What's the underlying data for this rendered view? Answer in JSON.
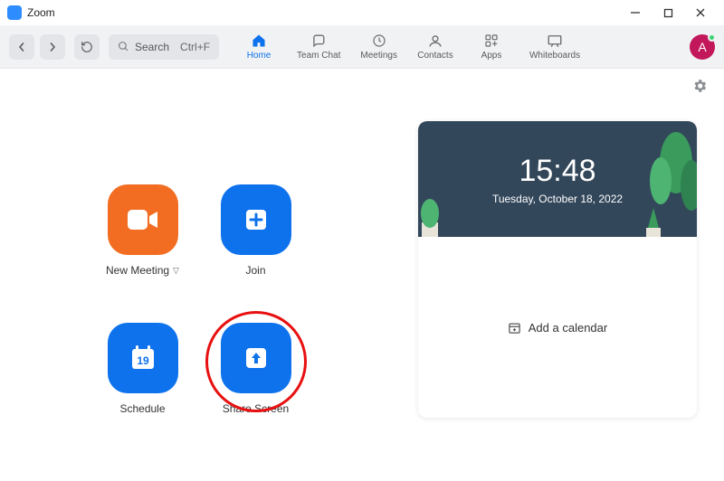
{
  "window": {
    "title": "Zoom"
  },
  "toolbar": {
    "search_placeholder": "Search",
    "search_shortcut": "Ctrl+F"
  },
  "tabs": {
    "home": "Home",
    "team_chat": "Team Chat",
    "meetings": "Meetings",
    "contacts": "Contacts",
    "apps": "Apps",
    "whiteboards": "Whiteboards"
  },
  "avatar": {
    "initial": "A"
  },
  "actions": {
    "new_meeting": "New Meeting",
    "join": "Join",
    "schedule": "Schedule",
    "schedule_day": "19",
    "share_screen": "Share Screen"
  },
  "hero": {
    "time": "15:48",
    "date": "Tuesday, October 18, 2022"
  },
  "side": {
    "add_calendar": "Add a calendar"
  }
}
